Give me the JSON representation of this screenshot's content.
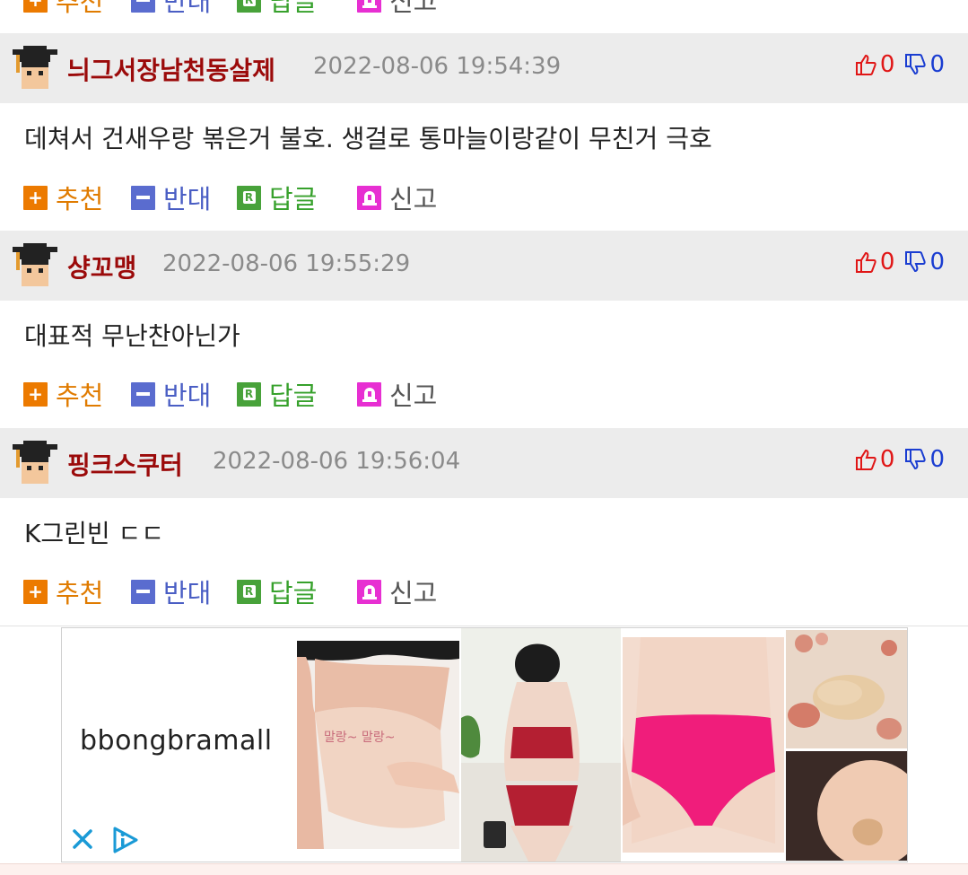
{
  "actions": {
    "recommend": "추천",
    "oppose": "반대",
    "reply": "답글",
    "report": "신고"
  },
  "comments": [
    {
      "author": "늬그서장남천동살제",
      "timestamp": "2022-08-06 19:54:39",
      "upvotes": "0",
      "downvotes": "0",
      "body": "데쳐서 건새우랑 볶은거 불호. 생걸로 통마늘이랑같이 무친거 극호"
    },
    {
      "author": "샹꼬맹",
      "timestamp": "2022-08-06 19:55:29",
      "upvotes": "0",
      "downvotes": "0",
      "body": "대표적 무난찬아닌가"
    },
    {
      "author": "핑크스쿠터",
      "timestamp": "2022-08-06 19:56:04",
      "upvotes": "0",
      "downvotes": "0",
      "body": "K그린빈 ㄷㄷ"
    }
  ],
  "ad": {
    "brand": "bbongbramall",
    "product_text": "말랑~ 말랑~"
  },
  "colors": {
    "author": "#9b0a0a",
    "upvote": "#e01616",
    "downvote": "#1a3dd1",
    "recommend": "#ec7a00",
    "oppose": "#5a6ccf",
    "reply": "#48a23a",
    "report": "#e72fd2"
  }
}
